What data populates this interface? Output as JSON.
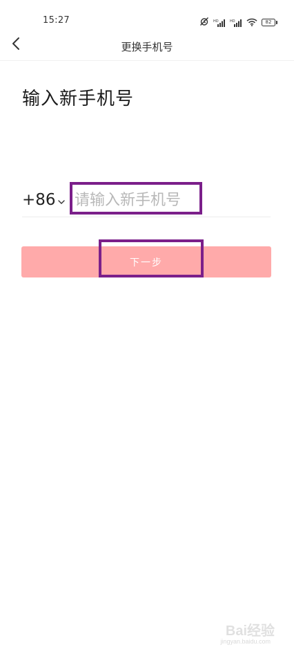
{
  "status_bar": {
    "time": "15:27",
    "battery": "82",
    "icons": [
      "alarm-off-icon",
      "hd-signal-icon",
      "hd-signal-icon",
      "wifi-icon",
      "battery-icon"
    ]
  },
  "nav": {
    "back_icon": "chevron-left-icon",
    "title": "更换手机号"
  },
  "heading": "输入新手机号",
  "phone": {
    "country_code": "+86",
    "placeholder": "请输入新手机号",
    "value": ""
  },
  "next_button_label": "下一步",
  "watermark": {
    "text": "Bai经验",
    "url": "jingyan.baidu.com"
  },
  "colors": {
    "button": "#ffaaaa",
    "highlight": "#7b1f8a",
    "placeholder": "#b8b8b8"
  }
}
